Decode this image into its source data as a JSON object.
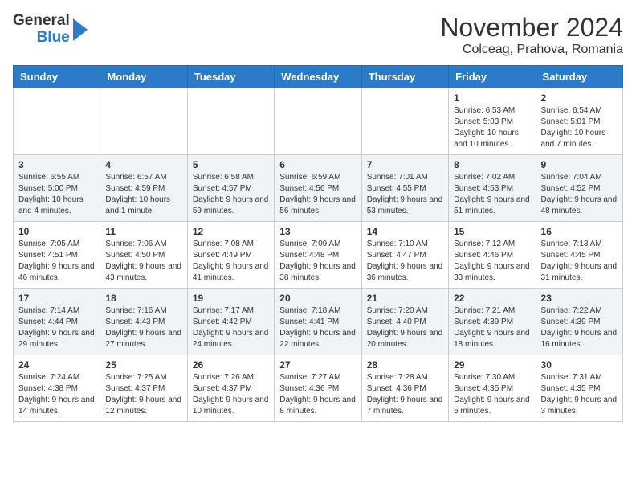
{
  "header": {
    "logo_general": "General",
    "logo_blue": "Blue",
    "month_title": "November 2024",
    "location": "Colceag, Prahova, Romania"
  },
  "days_of_week": [
    "Sunday",
    "Monday",
    "Tuesday",
    "Wednesday",
    "Thursday",
    "Friday",
    "Saturday"
  ],
  "weeks": [
    [
      {
        "day": "",
        "info": ""
      },
      {
        "day": "",
        "info": ""
      },
      {
        "day": "",
        "info": ""
      },
      {
        "day": "",
        "info": ""
      },
      {
        "day": "",
        "info": ""
      },
      {
        "day": "1",
        "info": "Sunrise: 6:53 AM\nSunset: 5:03 PM\nDaylight: 10 hours and 10 minutes."
      },
      {
        "day": "2",
        "info": "Sunrise: 6:54 AM\nSunset: 5:01 PM\nDaylight: 10 hours and 7 minutes."
      }
    ],
    [
      {
        "day": "3",
        "info": "Sunrise: 6:55 AM\nSunset: 5:00 PM\nDaylight: 10 hours and 4 minutes."
      },
      {
        "day": "4",
        "info": "Sunrise: 6:57 AM\nSunset: 4:59 PM\nDaylight: 10 hours and 1 minute."
      },
      {
        "day": "5",
        "info": "Sunrise: 6:58 AM\nSunset: 4:57 PM\nDaylight: 9 hours and 59 minutes."
      },
      {
        "day": "6",
        "info": "Sunrise: 6:59 AM\nSunset: 4:56 PM\nDaylight: 9 hours and 56 minutes."
      },
      {
        "day": "7",
        "info": "Sunrise: 7:01 AM\nSunset: 4:55 PM\nDaylight: 9 hours and 53 minutes."
      },
      {
        "day": "8",
        "info": "Sunrise: 7:02 AM\nSunset: 4:53 PM\nDaylight: 9 hours and 51 minutes."
      },
      {
        "day": "9",
        "info": "Sunrise: 7:04 AM\nSunset: 4:52 PM\nDaylight: 9 hours and 48 minutes."
      }
    ],
    [
      {
        "day": "10",
        "info": "Sunrise: 7:05 AM\nSunset: 4:51 PM\nDaylight: 9 hours and 46 minutes."
      },
      {
        "day": "11",
        "info": "Sunrise: 7:06 AM\nSunset: 4:50 PM\nDaylight: 9 hours and 43 minutes."
      },
      {
        "day": "12",
        "info": "Sunrise: 7:08 AM\nSunset: 4:49 PM\nDaylight: 9 hours and 41 minutes."
      },
      {
        "day": "13",
        "info": "Sunrise: 7:09 AM\nSunset: 4:48 PM\nDaylight: 9 hours and 38 minutes."
      },
      {
        "day": "14",
        "info": "Sunrise: 7:10 AM\nSunset: 4:47 PM\nDaylight: 9 hours and 36 minutes."
      },
      {
        "day": "15",
        "info": "Sunrise: 7:12 AM\nSunset: 4:46 PM\nDaylight: 9 hours and 33 minutes."
      },
      {
        "day": "16",
        "info": "Sunrise: 7:13 AM\nSunset: 4:45 PM\nDaylight: 9 hours and 31 minutes."
      }
    ],
    [
      {
        "day": "17",
        "info": "Sunrise: 7:14 AM\nSunset: 4:44 PM\nDaylight: 9 hours and 29 minutes."
      },
      {
        "day": "18",
        "info": "Sunrise: 7:16 AM\nSunset: 4:43 PM\nDaylight: 9 hours and 27 minutes."
      },
      {
        "day": "19",
        "info": "Sunrise: 7:17 AM\nSunset: 4:42 PM\nDaylight: 9 hours and 24 minutes."
      },
      {
        "day": "20",
        "info": "Sunrise: 7:18 AM\nSunset: 4:41 PM\nDaylight: 9 hours and 22 minutes."
      },
      {
        "day": "21",
        "info": "Sunrise: 7:20 AM\nSunset: 4:40 PM\nDaylight: 9 hours and 20 minutes."
      },
      {
        "day": "22",
        "info": "Sunrise: 7:21 AM\nSunset: 4:39 PM\nDaylight: 9 hours and 18 minutes."
      },
      {
        "day": "23",
        "info": "Sunrise: 7:22 AM\nSunset: 4:39 PM\nDaylight: 9 hours and 16 minutes."
      }
    ],
    [
      {
        "day": "24",
        "info": "Sunrise: 7:24 AM\nSunset: 4:38 PM\nDaylight: 9 hours and 14 minutes."
      },
      {
        "day": "25",
        "info": "Sunrise: 7:25 AM\nSunset: 4:37 PM\nDaylight: 9 hours and 12 minutes."
      },
      {
        "day": "26",
        "info": "Sunrise: 7:26 AM\nSunset: 4:37 PM\nDaylight: 9 hours and 10 minutes."
      },
      {
        "day": "27",
        "info": "Sunrise: 7:27 AM\nSunset: 4:36 PM\nDaylight: 9 hours and 8 minutes."
      },
      {
        "day": "28",
        "info": "Sunrise: 7:28 AM\nSunset: 4:36 PM\nDaylight: 9 hours and 7 minutes."
      },
      {
        "day": "29",
        "info": "Sunrise: 7:30 AM\nSunset: 4:35 PM\nDaylight: 9 hours and 5 minutes."
      },
      {
        "day": "30",
        "info": "Sunrise: 7:31 AM\nSunset: 4:35 PM\nDaylight: 9 hours and 3 minutes."
      }
    ]
  ]
}
